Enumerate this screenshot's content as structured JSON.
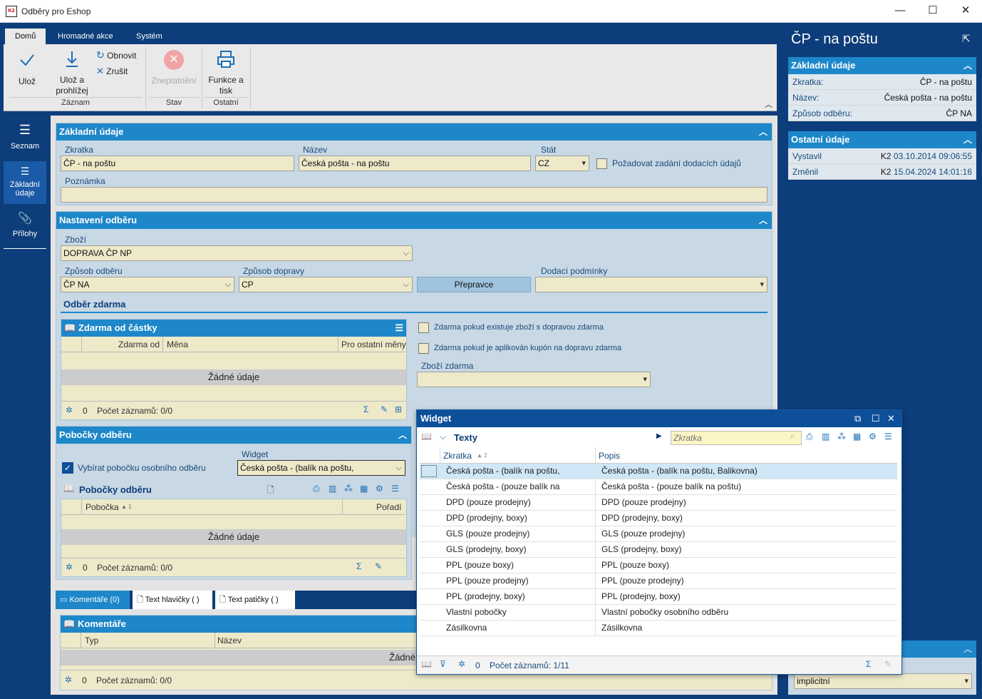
{
  "window": {
    "title": "Odběry pro Eshop"
  },
  "ribbon": {
    "tabs": [
      "Domů",
      "Hromadné akce",
      "Systém"
    ],
    "save": "Ulož",
    "save_view_line1": "Ulož a",
    "save_view_line2": "prohlížej",
    "refresh": "Obnovit",
    "cancel": "Zrušit",
    "group_record": "Záznam",
    "invalidate": "Zneplatnění",
    "group_status": "Stav",
    "functions_line1": "Funkce a",
    "functions_line2": "tisk",
    "group_other": "Ostatní"
  },
  "nav": {
    "list": "Seznam",
    "basic_line1": "Základní",
    "basic_line2": "údaje",
    "attachments": "Přílohy"
  },
  "basic": {
    "header": "Základní údaje",
    "abbr_label": "Zkratka",
    "abbr": "ČP - na poštu",
    "name_label": "Název",
    "name": "Česká pošta - na poštu",
    "country_label": "Stát",
    "country": "CZ",
    "require_delivery": "Požadovat zadání dodacích údajů",
    "note_label": "Poznámka",
    "note": ""
  },
  "settings": {
    "header": "Nastavení odběru",
    "goods_label": "Zboží",
    "goods": "DOPRAVA ČP NP",
    "method_label": "Způsob odběru",
    "method": "ČP NA",
    "transport_label": "Způsob dopravy",
    "transport": "CP",
    "carrier_button": "Přepravce",
    "delivery_terms_label": "Dodací podmínky",
    "delivery_terms": "",
    "free_section": "Odběr zdarma",
    "free_grid": {
      "title": "Zdarma od částky",
      "cols": [
        "Zdarma od",
        "Měna",
        "Pro ostatní měny"
      ],
      "empty": "Žádné údaje",
      "count": "0",
      "records": "Počet záznamů: 0/0"
    },
    "free_if_goods": "Zdarma pokud existuje zboží s dopravou zdarma",
    "free_if_coupon": "Zdarma pokud je aplikován kupón na dopravu zdarma",
    "free_goods_label": "Zboží zdarma",
    "free_goods": ""
  },
  "branches": {
    "header": "Pobočky odběru",
    "select_branch": "Vybírat pobočku osobního odběru",
    "widget_label": "Widget",
    "widget": "Česká pošta - (balík na poštu,",
    "grid_title": "Pobočky odběru",
    "cols": [
      "Pobočka",
      "Pořadí"
    ],
    "sort_mark": "▲ 1",
    "empty": "Žádné údaje",
    "count": "0",
    "records": "Počet záznamů: 0/0"
  },
  "bottom_tabs": [
    "Komentáře (0)",
    "Text hlavičky ( )",
    "Text patičky ( )"
  ],
  "comments": {
    "title": "Komentáře",
    "cols": [
      "Typ",
      "Název"
    ],
    "empty": "Žádné",
    "count": "0",
    "records": "Počet záznamů: 0/0"
  },
  "right": {
    "title": "ČP - na poštu",
    "basic_header": "Základní údaje",
    "rows": [
      {
        "k": "Zkratka:",
        "v": "ČP - na poštu"
      },
      {
        "k": "Název:",
        "v": "Česká pošta - na poštu"
      },
      {
        "k": "Způsob odběru:",
        "v": "ČP NA"
      }
    ],
    "other_header": "Ostatní údaje",
    "created_label": "Vystavil",
    "created_user": "K2",
    "created_date": "03.10.2014 09:06:55",
    "modified_label": "Změnil",
    "modified_user": "K2",
    "modified_date": "15.04.2024 14:01:16",
    "bottom_select": "implicitní"
  },
  "widget": {
    "title": "Widget",
    "texts": "Texty",
    "search_placeholder": "Zkratka",
    "col1": "Zkratka",
    "col1_sort": "▲ 2",
    "col2": "Popis",
    "rows": [
      {
        "a": "Česká pošta - (balík na poštu,",
        "b": "Česká pošta - (balík na poštu, Balikovna)"
      },
      {
        "a": "Česká pošta - (pouze balík na",
        "b": "Česká pošta - (pouze balík na poštu)"
      },
      {
        "a": "DPD (pouze prodejny)",
        "b": "DPD (pouze prodejny)"
      },
      {
        "a": "DPD (prodejny, boxy)",
        "b": "DPD (prodejny, boxy)"
      },
      {
        "a": "GLS (pouze prodejny)",
        "b": "GLS (pouze prodejny)"
      },
      {
        "a": "GLS (prodejny, boxy)",
        "b": "GLS (prodejny, boxy)"
      },
      {
        "a": "PPL (pouze boxy)",
        "b": "PPL (pouze boxy)"
      },
      {
        "a": "PPL (pouze prodejny)",
        "b": "PPL (pouze prodejny)"
      },
      {
        "a": "PPL (prodejny, boxy)",
        "b": "PPL (prodejny, boxy)"
      },
      {
        "a": "Vlastní pobočky",
        "b": "Vlastní pobočky osobního odběru"
      },
      {
        "a": "Zásilkovna",
        "b": "Zásilkovna"
      }
    ],
    "count": "0",
    "records": "Počet záznamů: 1/11"
  }
}
